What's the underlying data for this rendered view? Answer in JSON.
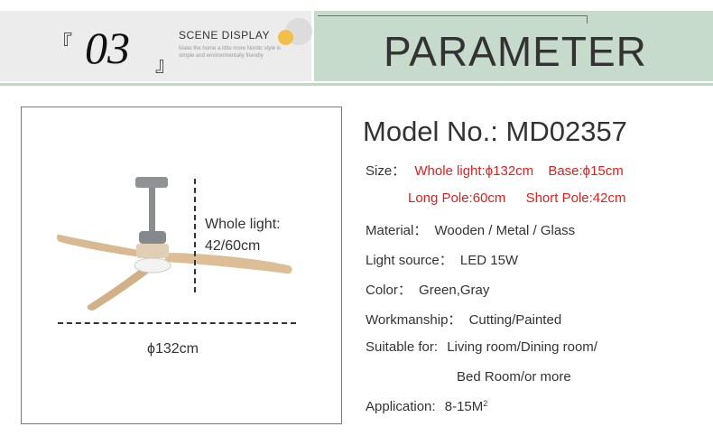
{
  "header": {
    "number": "03",
    "bracket_open": "『",
    "bracket_close": "』",
    "scene_title": "SCENE DISPLAY",
    "scene_sub": "Make the home a little more Nordic style is simple and environmentally friendly",
    "section_title": "PARAMETER"
  },
  "image": {
    "whole_light_label": "Whole light:",
    "whole_light_value": "42/60cm",
    "width_label": "ϕ132cm"
  },
  "specs": {
    "model": "Model No.: MD02357",
    "size_label": "Size：",
    "whole_light": "Whole light:ϕ132cm",
    "base": "Base:ϕ15cm",
    "long_pole": "Long Pole:60cm",
    "short_pole": "Short Pole:42cm",
    "material_label": "Material：",
    "material_value": "Wooden / Metal / Glass",
    "light_source_label": "Light source：",
    "light_source_value": "LED 15W",
    "color_label": "Color：",
    "color_value": "Green,Gray",
    "workmanship_label": "Workmanship：",
    "workmanship_value": "Cutting/Painted",
    "suitable_label": "Suitable for:",
    "suitable_value_1": "Living room/Dining room/",
    "suitable_value_2": "Bed Room/or more",
    "application_label": "Application:",
    "application_value": "8-15M",
    "application_sup": "2"
  },
  "colors": {
    "accent_green": "#c7dbcd",
    "header_gray": "#ececec",
    "highlight_red": "#e0201e",
    "dot_yellow": "#f1c04a"
  }
}
